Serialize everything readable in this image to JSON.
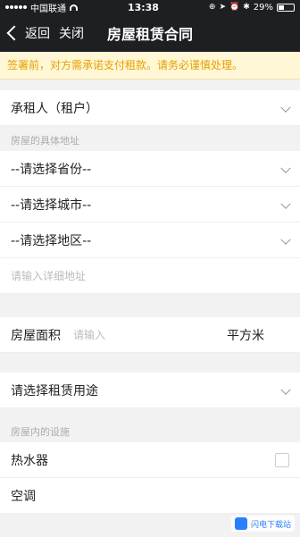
{
  "status": {
    "carrier": "中国联通",
    "time": "13:38",
    "battery": "29%"
  },
  "nav": {
    "back": "返回",
    "close": "关闭",
    "title": "房屋租赁合同"
  },
  "notice": "签署前，对方需承诺支付租款。请务必谨慎处理。",
  "tenant_row": "承租人（租户）",
  "address_section": "房屋的具体地址",
  "province_select": "--请选择省份--",
  "city_select": "--请选择城市--",
  "district_select": "--请选择地区--",
  "address_placeholder": "请输入详细地址",
  "area": {
    "label": "房屋面积",
    "placeholder": "请输入",
    "unit": "平方米"
  },
  "usage_select": "请选择租赁用途",
  "facilities_section": "房屋内的设施",
  "facilities": [
    "热水器",
    "空调"
  ],
  "watermark": "闪电下载站"
}
